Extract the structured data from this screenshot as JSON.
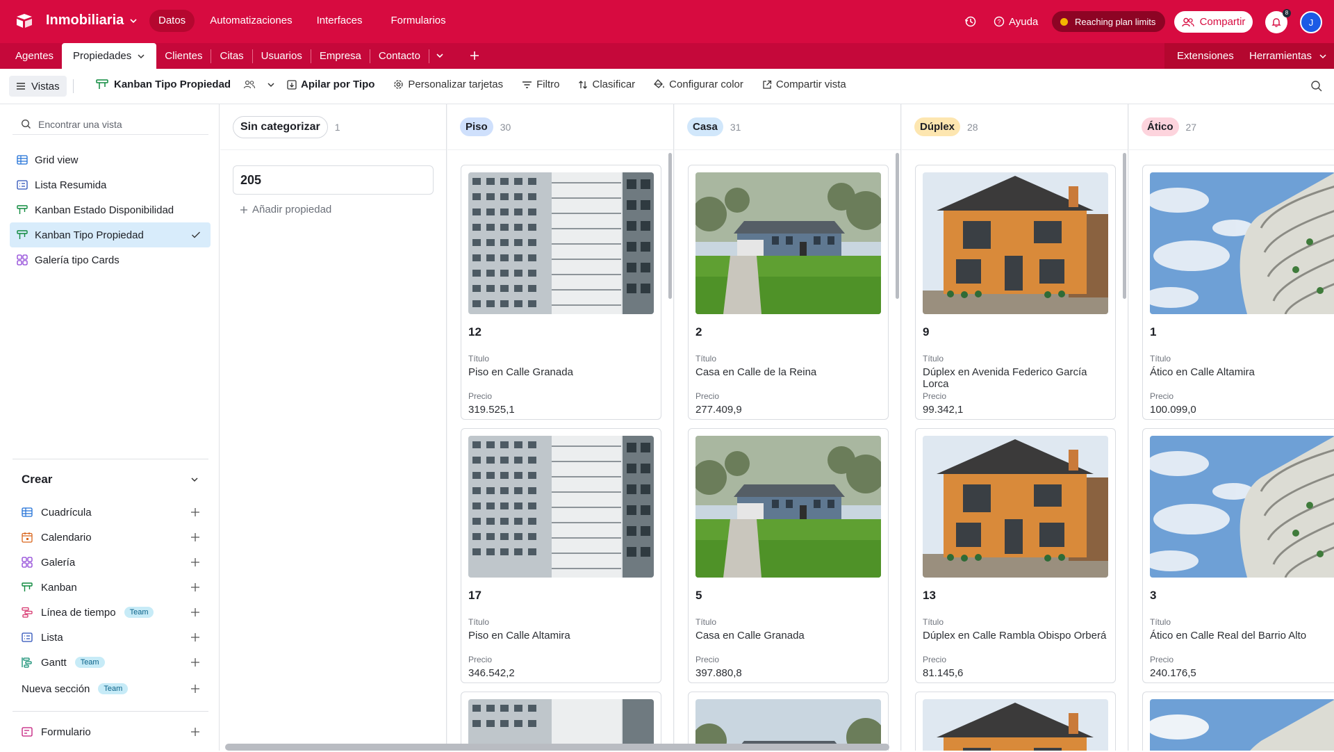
{
  "app": {
    "name": "Inmobiliaria"
  },
  "top_nav": [
    "Datos",
    "Automatizaciones",
    "Interfaces",
    "Formularios"
  ],
  "top_right": {
    "help": "Ayuda",
    "limits": "Reaching plan limits",
    "share": "Compartir",
    "notifications": "8",
    "avatar": "J"
  },
  "tables": [
    "Agentes",
    "Propiedades",
    "Clientes",
    "Citas",
    "Usuarios",
    "Empresa",
    "Contacto"
  ],
  "table_right": {
    "extensions": "Extensiones",
    "tools": "Herramientas"
  },
  "viewbar": {
    "views": "Vistas",
    "current_view": "Kanban Tipo Propiedad",
    "tools": [
      "Apilar por Tipo",
      "Personalizar tarjetas",
      "Filtro",
      "Clasificar",
      "Configurar color",
      "Compartir vista"
    ]
  },
  "sidebar": {
    "find_placeholder": "Encontrar una vista",
    "views": [
      {
        "label": "Grid view",
        "icon": "grid-icon"
      },
      {
        "label": "Lista Resumida",
        "icon": "list-icon"
      },
      {
        "label": "Kanban Estado Disponibilidad",
        "icon": "kanban-icon"
      },
      {
        "label": "Kanban Tipo Propiedad",
        "icon": "kanban-icon"
      },
      {
        "label": "Galería tipo Cards",
        "icon": "gallery-icon"
      }
    ],
    "create_title": "Crear",
    "create_items": [
      "Cuadrícula",
      "Calendario",
      "Galería",
      "Kanban",
      "Línea de tiempo",
      "Lista",
      "Gantt"
    ],
    "team_badge": "Team",
    "new_section": "Nueva sección",
    "form": "Formulario"
  },
  "board": {
    "uncategorized": {
      "label": "Sin categorizar",
      "count": "1",
      "card_value": "205",
      "add_property": "Añadir propiedad"
    },
    "field_titulo": "Título",
    "field_precio": "Precio",
    "columns": [
      {
        "label": "Piso",
        "count": "30",
        "color": "#cfe0fc",
        "cards": [
          {
            "num": "12",
            "titulo": "Piso en Calle Granada",
            "precio": "319.525,1"
          },
          {
            "num": "17",
            "titulo": "Piso en Calle Altamira",
            "precio": "346.542,2"
          }
        ]
      },
      {
        "label": "Casa",
        "count": "31",
        "color": "#d1e7fb",
        "cards": [
          {
            "num": "2",
            "titulo": "Casa en Calle de la Reina",
            "precio": "277.409,9"
          },
          {
            "num": "5",
            "titulo": "Casa en Calle Granada",
            "precio": "397.880,8"
          }
        ]
      },
      {
        "label": "Dúplex",
        "count": "28",
        "color": "#fde6b0",
        "cards": [
          {
            "num": "9",
            "titulo": "Dúplex en Avenida Federico García Lorca",
            "precio": "99.342,1"
          },
          {
            "num": "13",
            "titulo": "Dúplex en Calle Rambla Obispo Orberá",
            "precio": "81.145,6"
          }
        ]
      },
      {
        "label": "Ático",
        "count": "27",
        "color": "#fdd4dd",
        "cards": [
          {
            "num": "1",
            "titulo": "Ático en Calle Altamira",
            "precio": "100.099,0"
          },
          {
            "num": "3",
            "titulo": "Ático en Calle Real del Barrio Alto",
            "precio": "240.176,5"
          }
        ]
      }
    ]
  }
}
